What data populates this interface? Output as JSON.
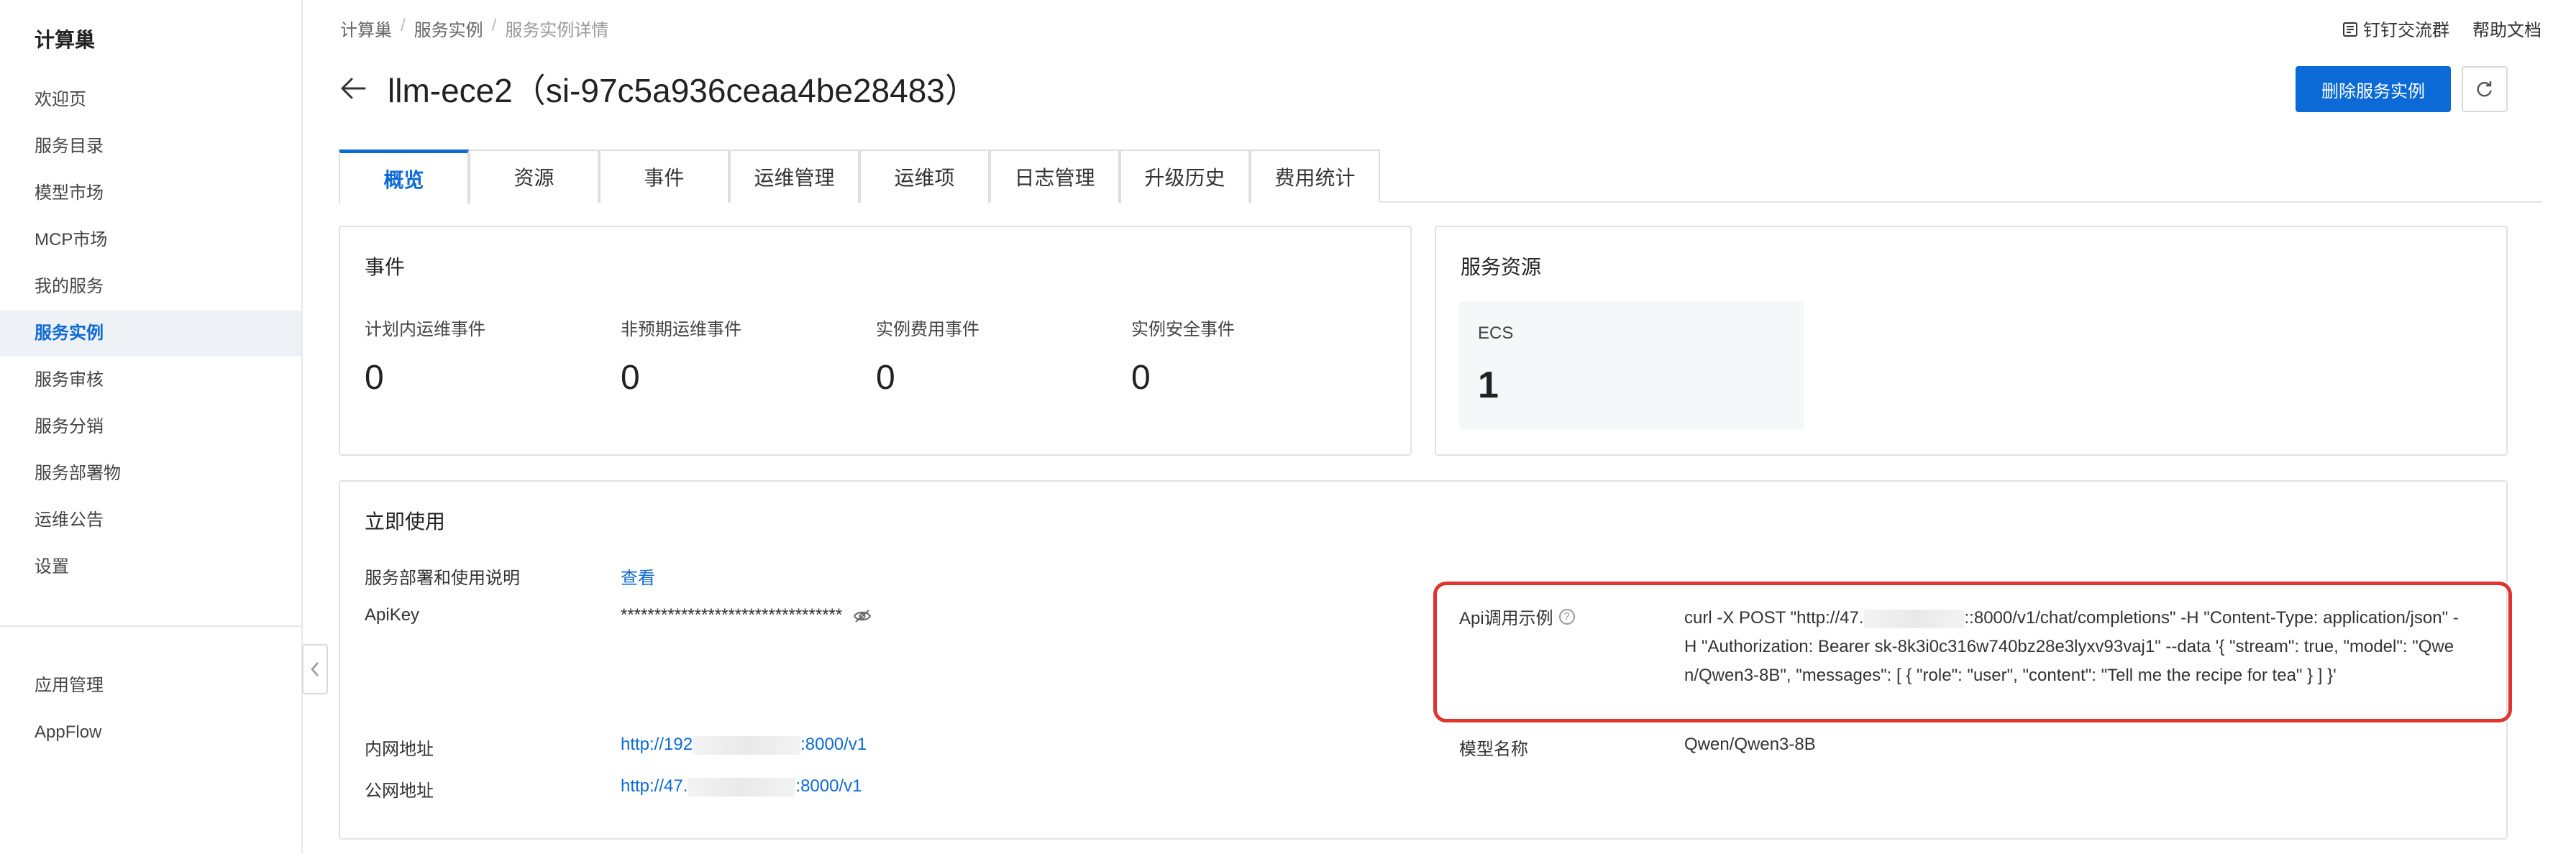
{
  "sidebar": {
    "brand": "计算巢",
    "items": [
      {
        "label": "欢迎页"
      },
      {
        "label": "服务目录"
      },
      {
        "label": "模型市场"
      },
      {
        "label": "MCP市场"
      },
      {
        "label": "我的服务"
      },
      {
        "label": "服务实例",
        "active": true
      },
      {
        "label": "服务审核"
      },
      {
        "label": "服务分销"
      },
      {
        "label": "服务部署物"
      },
      {
        "label": "运维公告"
      },
      {
        "label": "设置"
      }
    ],
    "bottom_items": [
      {
        "label": "应用管理"
      },
      {
        "label": "AppFlow"
      }
    ]
  },
  "breadcrumb": [
    "计算巢",
    "服务实例",
    "服务实例详情"
  ],
  "top_links": {
    "dingtalk": "钉钉交流群",
    "help": "帮助文档"
  },
  "title": "llm-ece2（si-97c5a936ceaa4be28483）",
  "buttons": {
    "delete": "删除服务实例"
  },
  "tabs": [
    "概览",
    "资源",
    "事件",
    "运维管理",
    "运维项",
    "日志管理",
    "升级历史",
    "费用统计"
  ],
  "events_card": {
    "title": "事件",
    "stats": [
      {
        "label": "计划内运维事件",
        "value": "0"
      },
      {
        "label": "非预期运维事件",
        "value": "0"
      },
      {
        "label": "实例费用事件",
        "value": "0"
      },
      {
        "label": "实例安全事件",
        "value": "0"
      }
    ]
  },
  "resources_card": {
    "title": "服务资源",
    "items": [
      {
        "label": "ECS",
        "value": "1"
      }
    ]
  },
  "usage_card": {
    "title": "立即使用",
    "deploy_doc_label": "服务部署和使用说明",
    "deploy_doc_link": "查看",
    "apikey_label": "ApiKey",
    "apikey_value": "*********************************",
    "intranet_label": "内网地址",
    "intranet_prefix": "http://192",
    "intranet_suffix": ":8000/v1",
    "public_label": "公网地址",
    "public_prefix": "http://47.",
    "public_suffix": ":8000/v1",
    "api_label": "Api调用示例",
    "api_code_prefix": "curl -X POST \"http://47.",
    "api_code_suffix": "::8000/v1/chat/completions\" -H \"Content-Type: application/json\" -H \"Authorization: Bearer sk-8k3i0c316w740bz28e3lyxv93vaj1\" --data '{ \"stream\": true, \"model\": \"Qwen/Qwen3-8B\",  \"messages\": [ { \"role\": \"user\", \"content\": \"Tell me the recipe for tea\" } ] }'",
    "model_label": "模型名称",
    "model_value": "Qwen/Qwen3-8B"
  },
  "colors": {
    "accent": "#0b6ad6",
    "highlight": "#e1342f"
  }
}
